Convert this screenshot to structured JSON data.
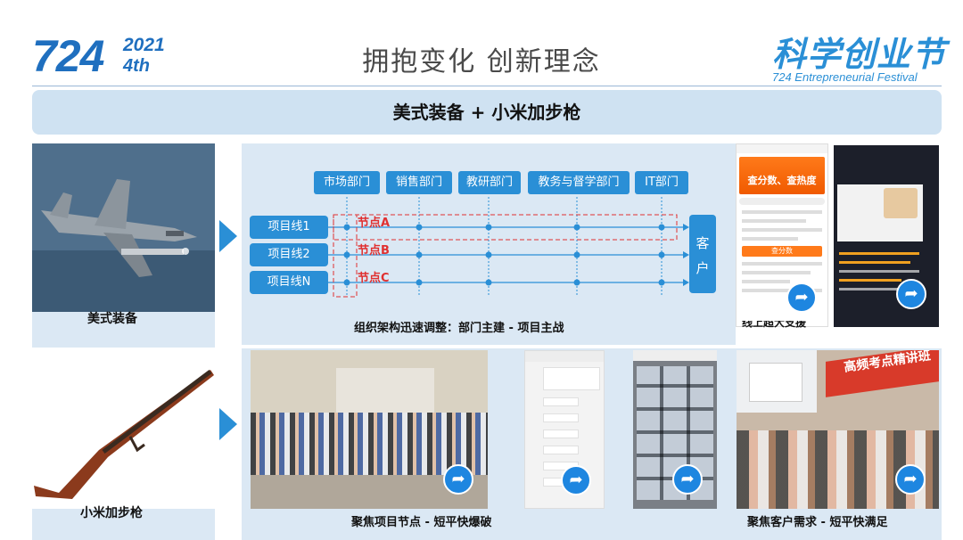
{
  "header": {
    "logo_number": "724",
    "logo_year": "2021",
    "logo_ordinal": "4th",
    "title": "拥抱变化  创新理念",
    "brand": "科学创业节",
    "brand_sub": "724 Entrepreneurial Festival"
  },
  "banner": {
    "text": "美式装备  +  小米加步枪"
  },
  "left": {
    "jet_caption": "美式装备",
    "rifle_caption": "小米加步枪"
  },
  "org": {
    "departments": [
      "市场部门",
      "销售部门",
      "教研部门",
      "教务与督学部门",
      "IT部门"
    ],
    "project_lines": [
      "项目线1",
      "项目线2",
      "项目线N"
    ],
    "nodes": [
      "节点A",
      "节点B",
      "节点C"
    ],
    "client": [
      "客",
      "户"
    ],
    "caption": "组织架构迅速调整：部门主建 - 项目主战"
  },
  "phone1": {
    "title": "",
    "banner": "查分数、查热度",
    "button": "查分数"
  },
  "phone_caption_partial": "线上超大支援",
  "bottom": {
    "caption_left": "聚焦项目节点 - 短平快爆破",
    "caption_right": "聚焦客户需求 - 短平快满足",
    "classroom_banner": "高频考点精讲班"
  },
  "colors": {
    "accent": "#2a8fd6",
    "panel": "#dbe8f4",
    "banner": "#cfe2f2",
    "node_red": "#e03030"
  },
  "icons": {
    "share": "share-arrow-icon",
    "arrow": "right-triangle-arrow-icon"
  }
}
